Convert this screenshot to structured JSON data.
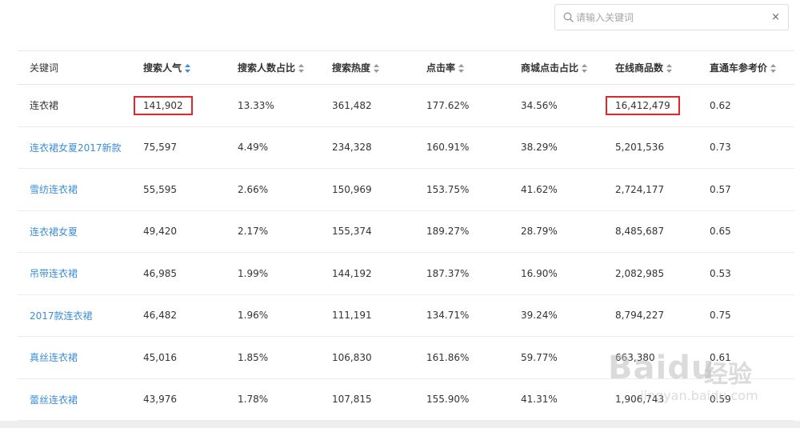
{
  "search": {
    "placeholder": "请输入关键词",
    "value": "",
    "clear_symbol": "×"
  },
  "table": {
    "headers": [
      {
        "label": "关键词",
        "sortable": false
      },
      {
        "label": "搜索人气",
        "sortable": true,
        "active": true
      },
      {
        "label": "搜索人数占比",
        "sortable": true
      },
      {
        "label": "搜索热度",
        "sortable": true
      },
      {
        "label": "点击率",
        "sortable": true
      },
      {
        "label": "商城点击占比",
        "sortable": true
      },
      {
        "label": "在线商品数",
        "sortable": true
      },
      {
        "label": "直通车参考价",
        "sortable": true
      }
    ],
    "rows": [
      {
        "keyword": "连衣裙",
        "popularity": "141,902",
        "search_ratio": "13.33%",
        "heat": "361,482",
        "ctr": "177.62%",
        "mall_ratio": "34.56%",
        "products": "16,412,479",
        "price": "0.62"
      },
      {
        "keyword": "连衣裙女夏2017新款",
        "popularity": "75,597",
        "search_ratio": "4.49%",
        "heat": "234,328",
        "ctr": "160.91%",
        "mall_ratio": "38.29%",
        "products": "5,201,536",
        "price": "0.73"
      },
      {
        "keyword": "雪纺连衣裙",
        "popularity": "55,595",
        "search_ratio": "2.66%",
        "heat": "150,969",
        "ctr": "153.75%",
        "mall_ratio": "41.62%",
        "products": "2,724,177",
        "price": "0.57"
      },
      {
        "keyword": "连衣裙女夏",
        "popularity": "49,420",
        "search_ratio": "2.17%",
        "heat": "155,374",
        "ctr": "189.27%",
        "mall_ratio": "28.79%",
        "products": "8,485,687",
        "price": "0.65"
      },
      {
        "keyword": "吊带连衣裙",
        "popularity": "46,985",
        "search_ratio": "1.99%",
        "heat": "144,192",
        "ctr": "187.37%",
        "mall_ratio": "16.90%",
        "products": "2,082,985",
        "price": "0.53"
      },
      {
        "keyword": "2017款连衣裙",
        "popularity": "46,482",
        "search_ratio": "1.96%",
        "heat": "111,191",
        "ctr": "134.71%",
        "mall_ratio": "39.24%",
        "products": "8,794,227",
        "price": "0.75"
      },
      {
        "keyword": "真丝连衣裙",
        "popularity": "45,016",
        "search_ratio": "1.85%",
        "heat": "106,830",
        "ctr": "161.86%",
        "mall_ratio": "59.77%",
        "products": "663,380",
        "price": "0.61"
      },
      {
        "keyword": "蕾丝连衣裙",
        "popularity": "43,976",
        "search_ratio": "1.78%",
        "heat": "107,815",
        "ctr": "155.90%",
        "mall_ratio": "41.31%",
        "products": "1,906,743",
        "price": "0.59"
      }
    ]
  },
  "watermark": {
    "brand": "Baidu",
    "brand_suffix": "经验",
    "url": "jingyan.baidu.com"
  },
  "colors": {
    "link": "#3a8ed8",
    "highlight_border": "#e3242b",
    "sort_active": "#3a8ed8",
    "sort_inactive": "#999999"
  },
  "icons": {
    "search": "search-icon",
    "clear": "close-icon",
    "sort": "sort-icon"
  }
}
